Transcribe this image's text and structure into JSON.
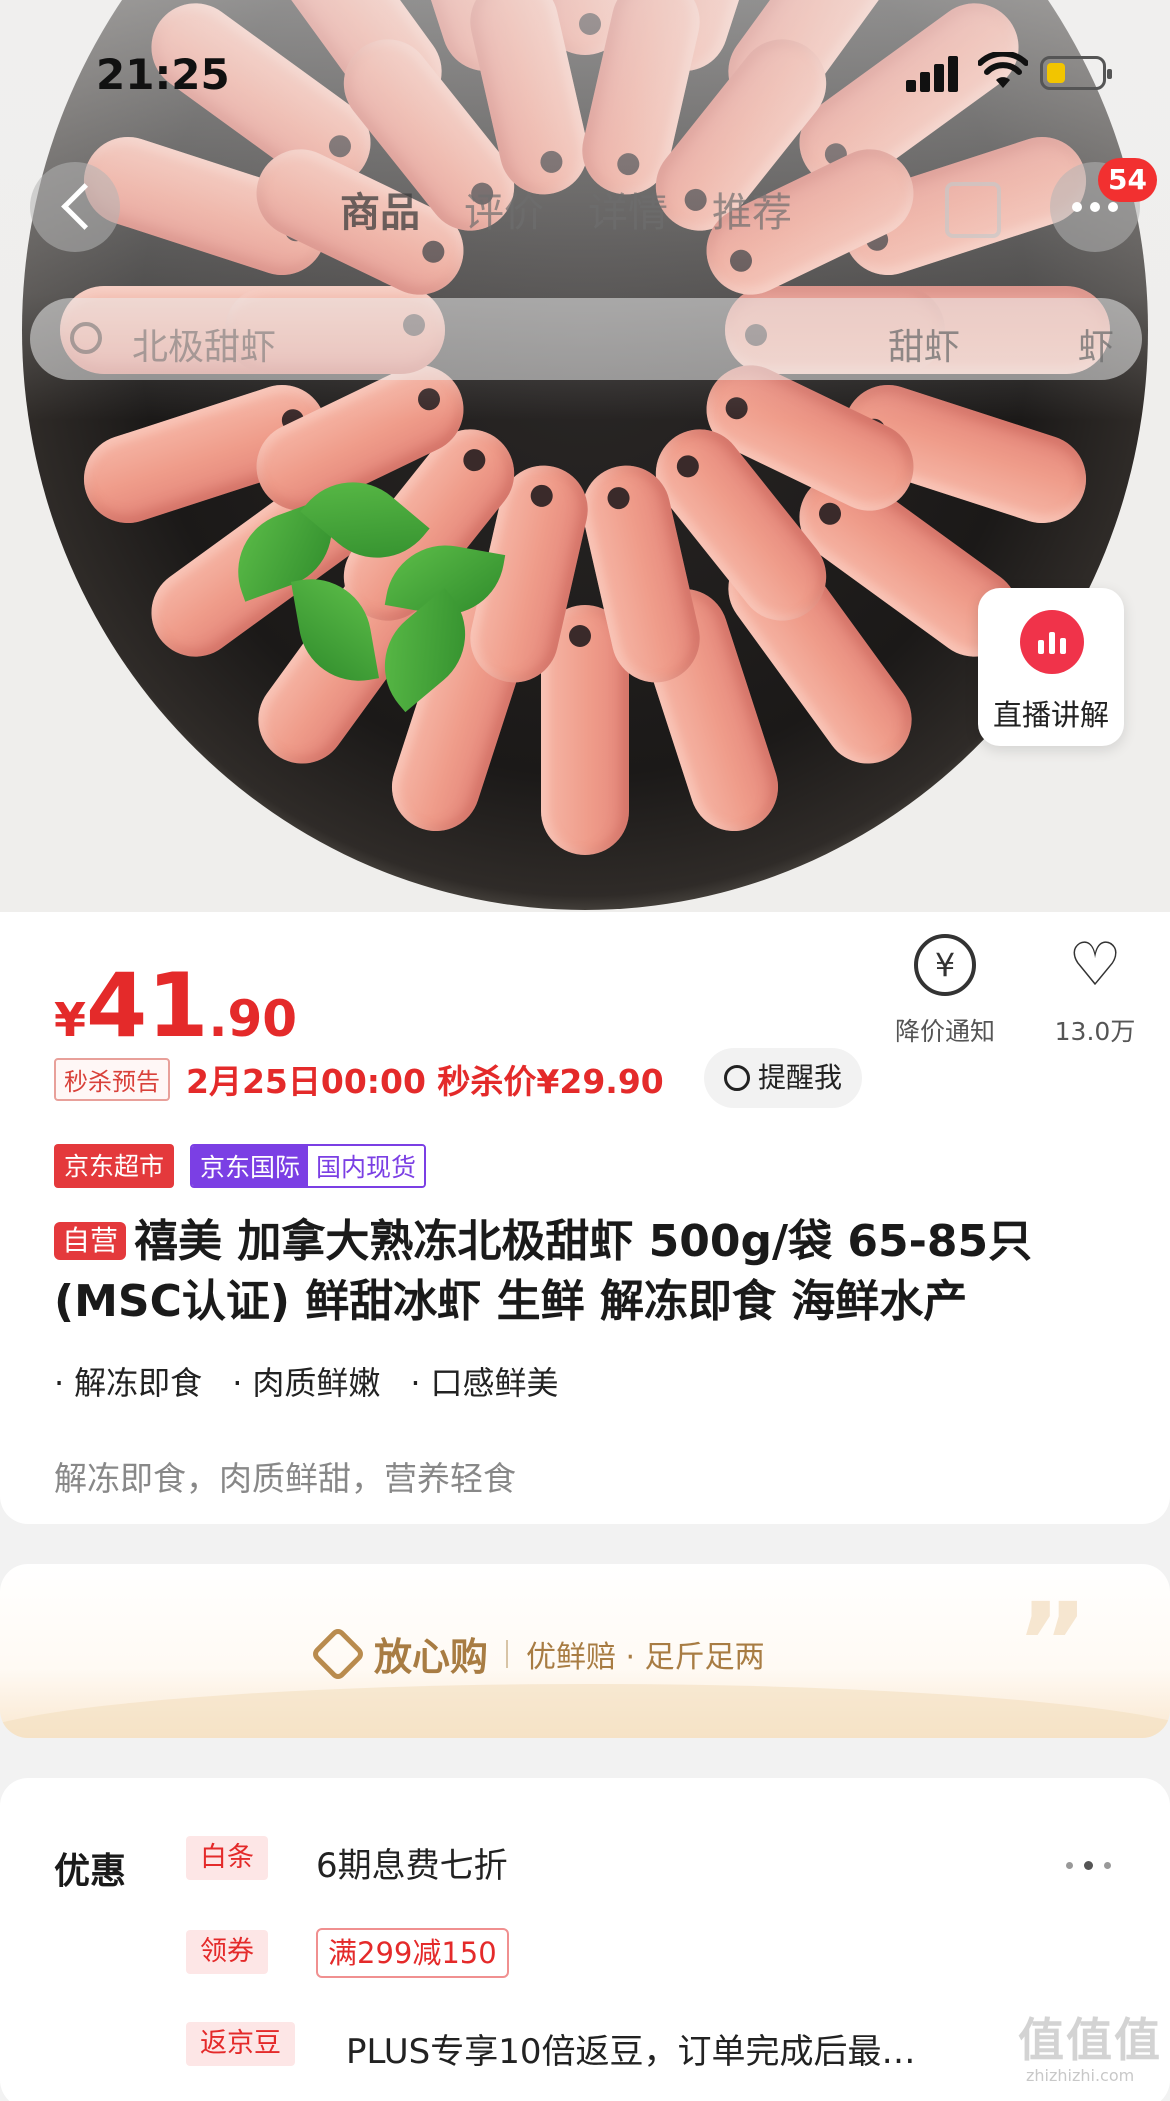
{
  "status_bar": {
    "time": "21:25"
  },
  "nav": {
    "tabs": [
      "商品",
      "评价",
      "详情",
      "推荐"
    ],
    "active_tab": 0,
    "cart_badge": "54",
    "search_text": "北极甜虾",
    "chips": [
      "甜虾",
      "虾"
    ]
  },
  "live": {
    "label": "直播讲解"
  },
  "product": {
    "price_currency": "¥",
    "price_int": "41",
    "price_dec": ".90",
    "notify_label": "降价通知",
    "fav_count": "13.0万",
    "flash_tag": "秒杀预告",
    "flash_text": "2月25日00:00 秒杀价¥29.90",
    "remind_label": "提醒我",
    "tag_store": "京东超市",
    "tag_intl_a": "京东国际",
    "tag_intl_b": "国内现货",
    "self_tag": "自营",
    "title": "禧美 加拿大熟冻北极甜虾 500g/袋 65-85只(MSC认证) 鲜甜冰虾 生鲜 解冻即食 海鲜水产",
    "bullets": [
      "解冻即食",
      "肉质鲜嫩",
      "口感鲜美"
    ],
    "slogan": "解冻即食，肉质鲜甜，营养轻食"
  },
  "assurance": {
    "title": "放心购",
    "sub": "优鲜赔 · 足斤足两"
  },
  "promos": {
    "title": "优惠",
    "items": [
      {
        "tag": "白条",
        "text": "6期息费七折"
      },
      {
        "tag": "领券",
        "text": "满299减150"
      },
      {
        "tag": "返京豆",
        "text": "PLUS专享10倍返豆，订单完成后最…"
      }
    ]
  },
  "watermark": {
    "main": "值值值",
    "sub": "zhizhizhi.com"
  }
}
